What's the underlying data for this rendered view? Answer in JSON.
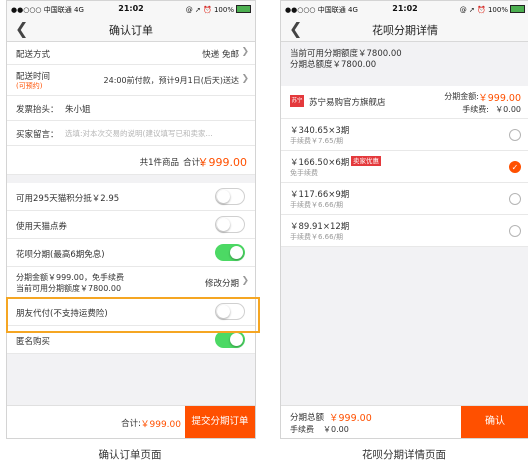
{
  "left_phone": {
    "status": {
      "carrier": "●●○○○ 中国联通  4G",
      "time": "21:02",
      "right": "@ ➚ ⏰ 100%"
    },
    "nav": {
      "title": "确认订单"
    },
    "delivery": {
      "label": "配送方式",
      "value": "快递 免邮"
    },
    "delivery_time": {
      "label": "配送时间",
      "sub": "(可预约)",
      "value": "24:00前付款，预计9月1日(后天)送达"
    },
    "invoice": {
      "label": "发票抬头：",
      "value": "朱小姐"
    },
    "message": {
      "label": "买家留言：",
      "placeholder": "选填:对本次交易的说明(建议填写已和卖家..."
    },
    "summary": {
      "count": "共1件商品",
      "total_label": "合计:",
      "total": "￥999.00"
    },
    "options": [
      {
        "label": "可用295天猫积分抵￥2.95",
        "on": false
      },
      {
        "label": "使用天猫点券",
        "on": false
      },
      {
        "label": "花呗分期(最高6期免息)",
        "on": true
      }
    ],
    "installment": {
      "line1": "分期金额￥999.00，免手续费",
      "line2": "当前可用分期额度￥7800.00",
      "action": "修改分期"
    },
    "options2": [
      {
        "label": "朋友代付(不支持运费险)",
        "on": false
      },
      {
        "label": "匿名购买",
        "on": true
      }
    ],
    "bottom": {
      "total_label": "合计:",
      "total": "￥999.00",
      "submit": "提交分期订单"
    },
    "caption": "确认订单页面"
  },
  "right_phone": {
    "status": {
      "carrier": "●●○○○ 中国联通  4G",
      "time": "21:02",
      "right": "@ ➚ ⏰ 100%"
    },
    "nav": {
      "title": "花呗分期详情"
    },
    "quota": {
      "line1": "当前可用分期额度￥7800.00",
      "line2": "分期总额度￥7800.00"
    },
    "store": {
      "badge": "苏宁",
      "name": "苏宁易购官方旗舰店",
      "amount_label": "分期金额:",
      "amount": "￥999.00",
      "fee_label": "手续费:",
      "fee": "￥0.00"
    },
    "plans": [
      {
        "main": "￥340.65×3期",
        "sub": "手续费￥7.65/期",
        "tag": "",
        "selected": false
      },
      {
        "main": "￥166.50×6期",
        "sub": "免手续费",
        "tag": "卖家优惠",
        "selected": true
      },
      {
        "main": "￥117.66×9期",
        "sub": "手续费￥6.66/期",
        "tag": "",
        "selected": false
      },
      {
        "main": "￥89.91×12期",
        "sub": "手续费￥6.66/期",
        "tag": "",
        "selected": false
      }
    ],
    "bottom": {
      "total_label": "分期总额",
      "total": "￥999.00",
      "fee_label": "手续费",
      "fee": "￥0.00",
      "confirm": "确认"
    },
    "caption": "花呗分期详情页面"
  },
  "colors": {
    "accent": "#ff5000",
    "toggle_on": "#4cd964",
    "highlight_border": "#f5a623",
    "tag_red": "#e4393c"
  }
}
